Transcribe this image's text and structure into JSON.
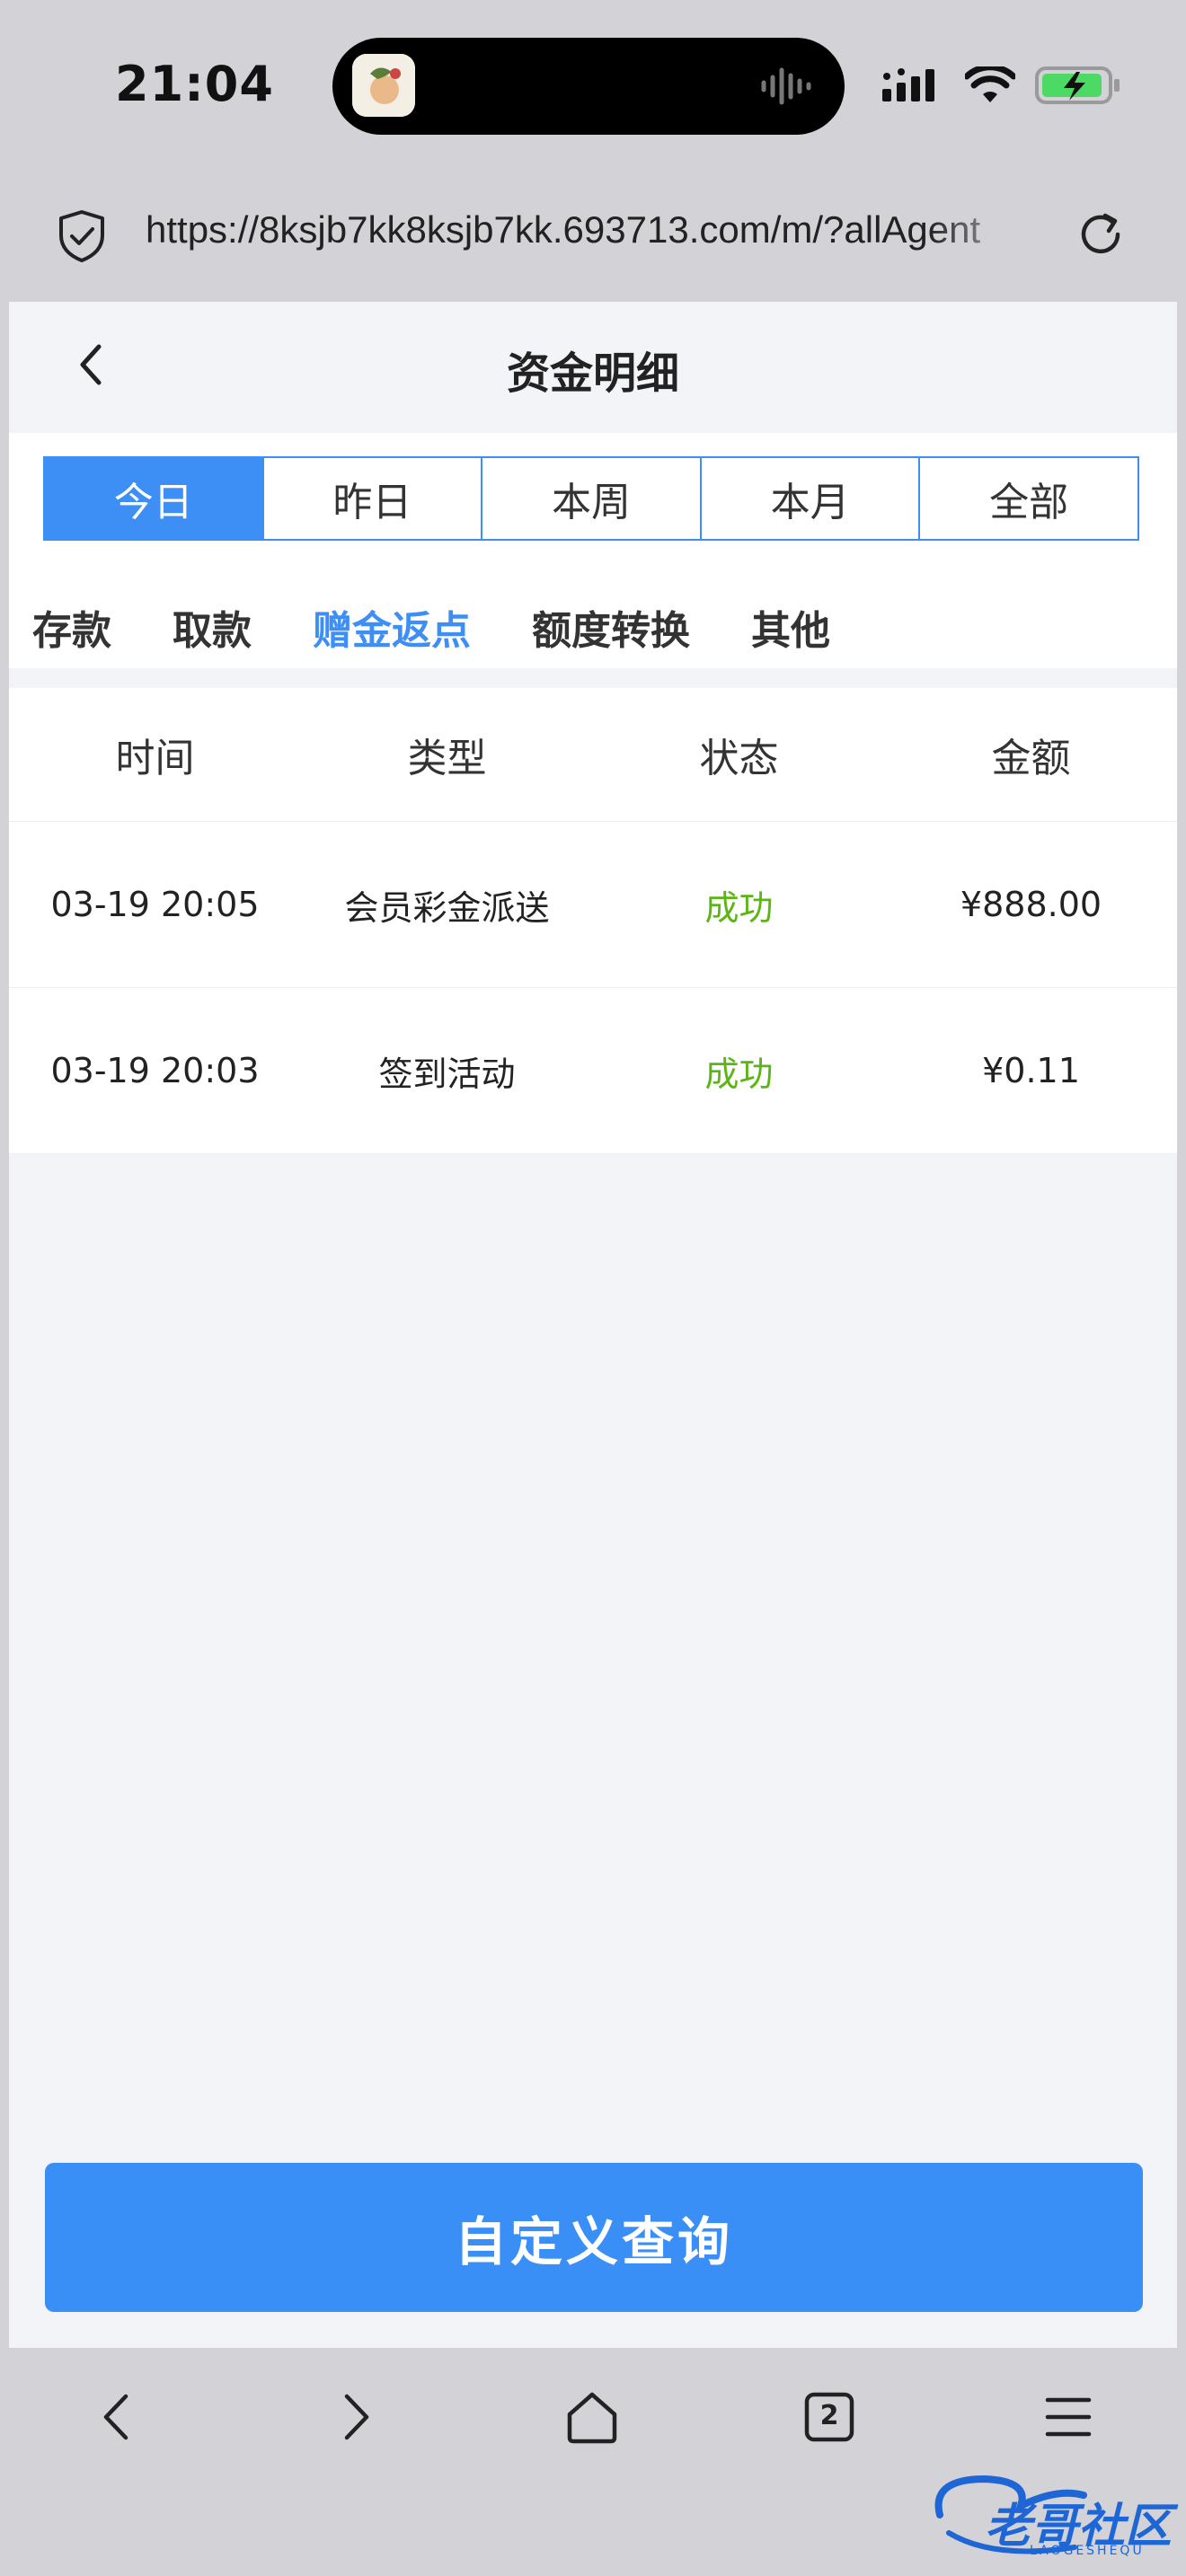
{
  "status_bar": {
    "time": "21:04"
  },
  "url_bar": {
    "url": "https://8ksjb7kk8ksjb7kk.693713.com/m/?allAgent"
  },
  "header": {
    "title": "资金明细"
  },
  "date_filters": [
    "今日",
    "昨日",
    "本周",
    "本月",
    "全部"
  ],
  "date_filter_active": "今日",
  "categories": [
    "存款",
    "取款",
    "赠金返点",
    "额度转换",
    "其他"
  ],
  "category_active": "赠金返点",
  "table": {
    "headers": [
      "时间",
      "类型",
      "状态",
      "金额"
    ],
    "rows": [
      {
        "time": "03-19 20:05",
        "type": "会员彩金派送",
        "status": "成功",
        "amount": "¥888.00"
      },
      {
        "time": "03-19 20:03",
        "type": "签到活动",
        "status": "成功",
        "amount": "¥0.11"
      }
    ]
  },
  "query_button": "自定义查询",
  "toolbar": {
    "tab_count": "2"
  },
  "watermark": {
    "text": "老哥社区",
    "subtext": "LAOGESHEQU"
  },
  "colors": {
    "accent": "#3d8ff5",
    "success": "#5bb515",
    "battery": "#4cd964"
  }
}
